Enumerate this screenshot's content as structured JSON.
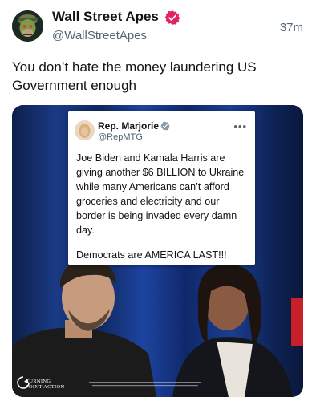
{
  "author": {
    "name": "Wall Street Apes",
    "handle": "@WallStreetApes",
    "verified_icon": "verified-badge-icon",
    "verified_color": "#e0245e"
  },
  "post": {
    "time": "37m",
    "text": "You don’t hate the money laundering US Government enough"
  },
  "media": {
    "quoted_post": {
      "name": "Rep. Marjorie",
      "handle": "@RepMTG",
      "verified_icon": "verified-badge-icon",
      "verified_color": "#829aab",
      "more": "•••",
      "body": "Joe Biden and Kamala Harris are giving another $6 BILLION to Ukraine while many Americans can’t afford groceries and electricity and our border is being invaded every damn day.",
      "closing": "Democrats are AMERICA LAST!!!"
    },
    "watermark": {
      "line1": "TURNING",
      "line2": "POINT ACTION"
    }
  },
  "colors": {
    "text_primary": "#0f1419",
    "text_secondary": "#536471",
    "media_background": "#0b1a3e"
  }
}
